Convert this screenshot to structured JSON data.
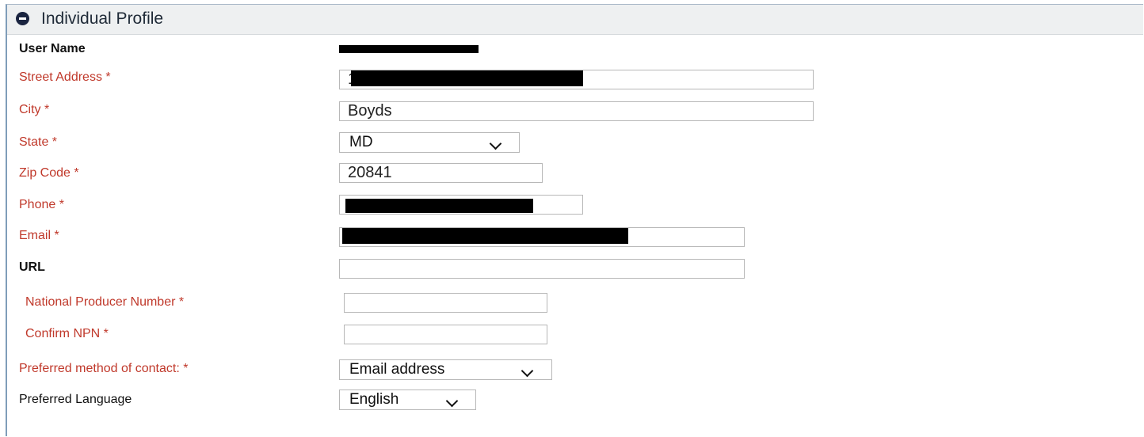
{
  "panel": {
    "title": "Individual Profile",
    "collapse_icon": "minus-circle-icon"
  },
  "fields": {
    "user_name": {
      "label": "User Name"
    },
    "street_address": {
      "label": "Street Address *",
      "value_prefix": "1"
    },
    "city": {
      "label": "City *",
      "value": "Boyds"
    },
    "state": {
      "label": "State *",
      "value": "MD"
    },
    "zip": {
      "label": "Zip Code *",
      "value": "20841"
    },
    "phone": {
      "label": "Phone *"
    },
    "email": {
      "label": "Email *"
    },
    "url": {
      "label": "URL",
      "value": ""
    },
    "npn": {
      "label": "National Producer Number *",
      "value": ""
    },
    "confirm_npn": {
      "label": "Confirm NPN *",
      "value": ""
    },
    "contact_method": {
      "label": "Preferred method of contact: *",
      "value": "Email address"
    },
    "language": {
      "label": "Preferred Language",
      "value": "English"
    }
  },
  "colors": {
    "required_label": "#c0392b",
    "header_bg": "#eef0f1",
    "border": "#7f9db9"
  }
}
